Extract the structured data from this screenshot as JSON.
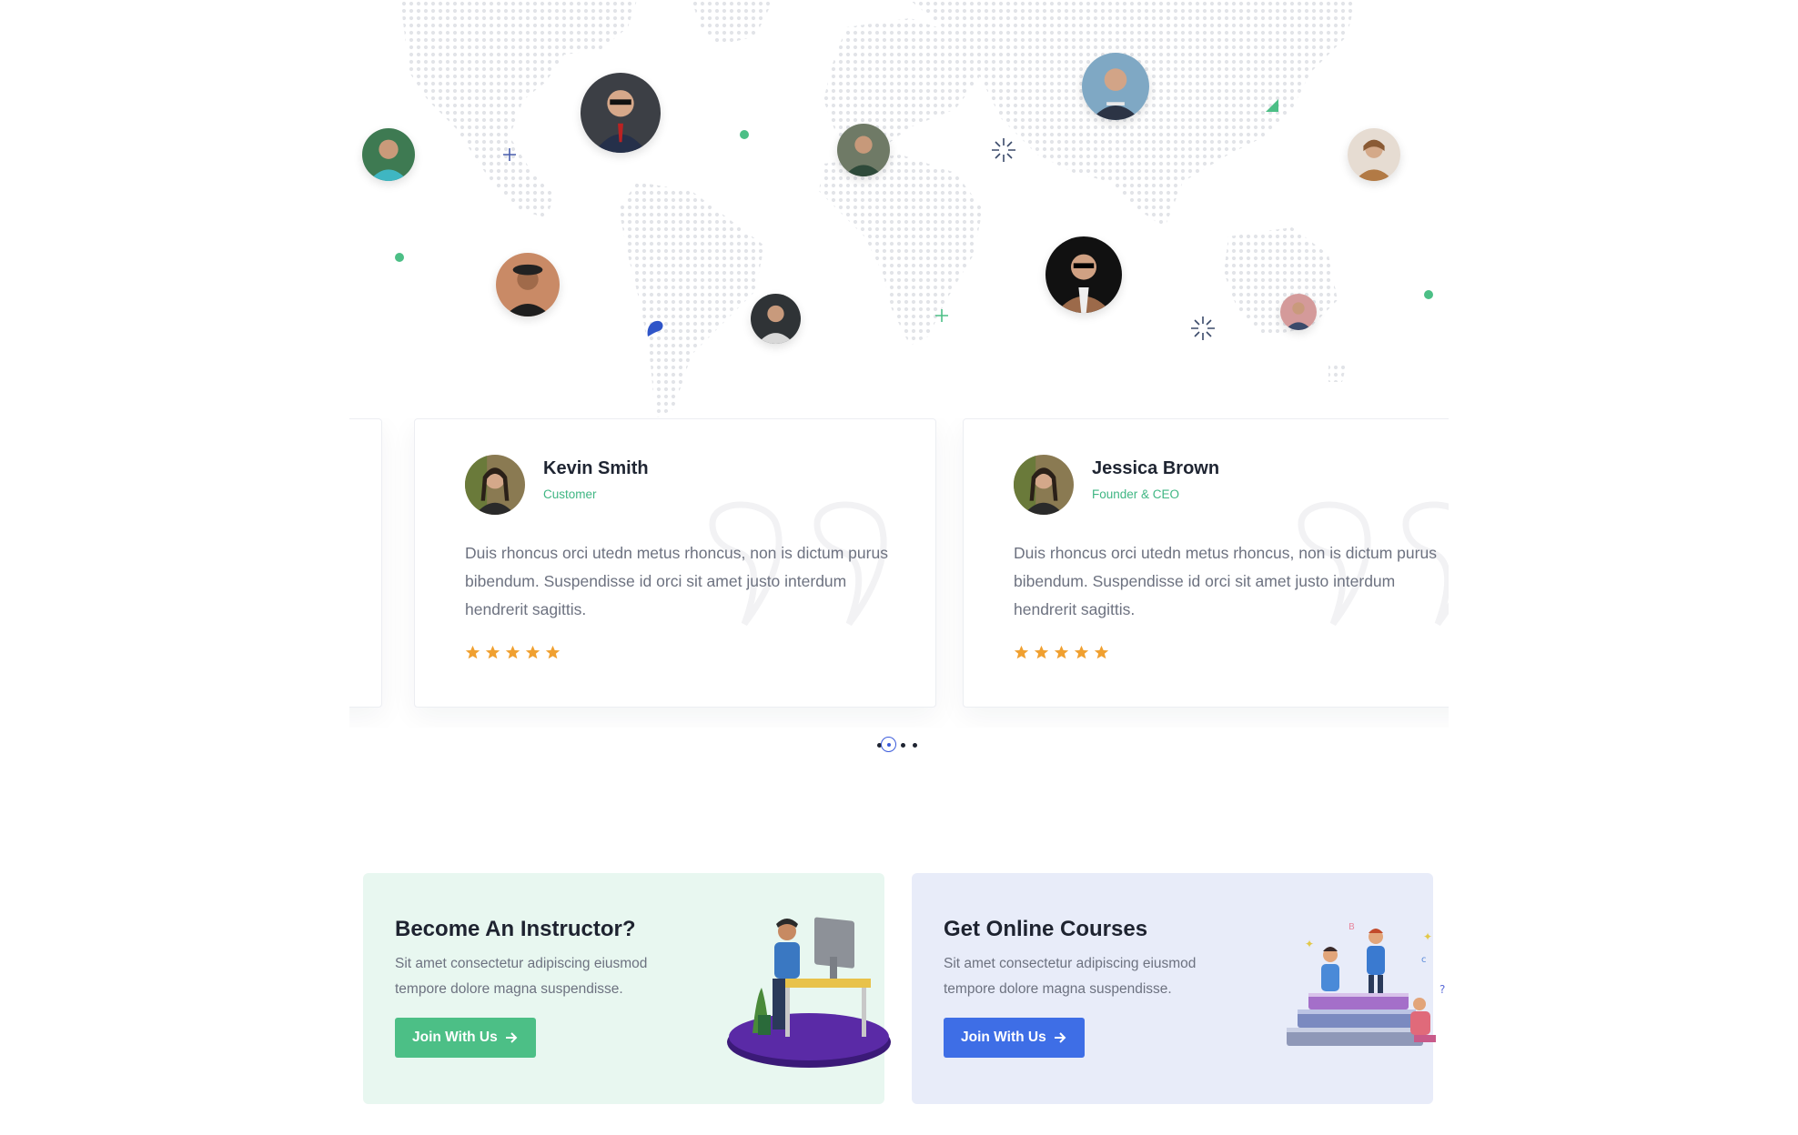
{
  "testimonials": [
    {
      "name": "Kevin Smith",
      "role": "Customer",
      "text": "Duis rhoncus orci utedn metus rhoncus, non is dictum purus bibendum. Suspendisse id orci sit amet justo interdum hendrerit sagittis.",
      "rating": 5
    },
    {
      "name": "Jessica Brown",
      "role": "Founder & CEO",
      "text": "Duis rhoncus orci utedn metus rhoncus, non is dictum purus bibendum. Suspendisse id orci sit amet justo interdum hendrerit sagittis.",
      "rating": 5
    }
  ],
  "pager": {
    "count": 3,
    "active": 1
  },
  "promos": {
    "instructor": {
      "title": "Become An Instructor?",
      "description": "Sit amet consectetur adipiscing eiusmod tempore dolore magna suspendisse.",
      "button": "Join With Us"
    },
    "courses": {
      "title": "Get Online Courses",
      "description": "Sit amet consectetur adipiscing eiusmod tempore dolore magna suspendisse.",
      "button": "Join With Us"
    }
  },
  "colors": {
    "green_accent": "#4cbf86",
    "blue_accent": "#3e6ee6",
    "star": "#f0a030",
    "role_text": "#3fb683"
  }
}
